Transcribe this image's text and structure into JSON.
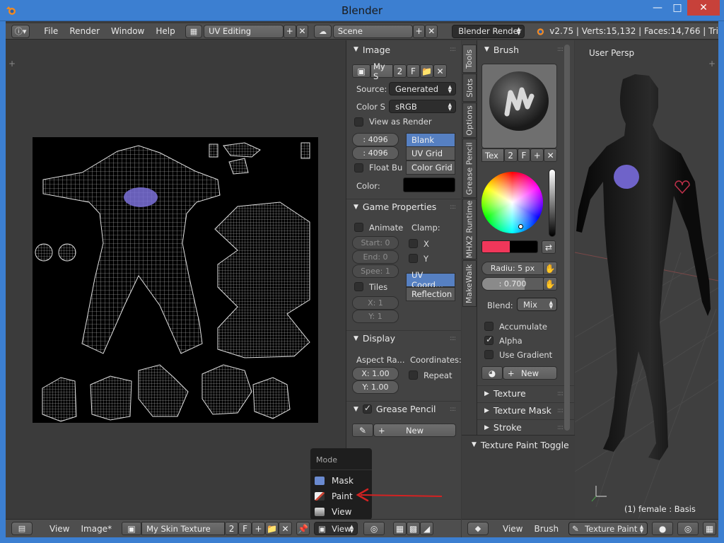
{
  "window": {
    "title": "Blender"
  },
  "info_header": {
    "menus": [
      "File",
      "Render",
      "Window",
      "Help"
    ],
    "screen_layout": "UV Editing",
    "scene": "Scene",
    "render_engine": "Blender Render",
    "stats": "v2.75 | Verts:15,132 | Faces:14,766 | Tri"
  },
  "image_panel": {
    "header": "Image",
    "image_name_short": "My S",
    "users": "2",
    "fake_user": "F",
    "source_label": "Source:",
    "source_value": "Generated",
    "color_space_label": "Color S",
    "color_space_value": "sRGB",
    "view_as_render": "View as Render",
    "width": ": 4096",
    "height": ": 4096",
    "float_buffer": "Float Bu",
    "generated_types": [
      "Blank",
      "UV Grid",
      "Color Grid"
    ],
    "color_label": "Color:"
  },
  "game_properties": {
    "header": "Game Properties",
    "animate": "Animate",
    "clamp_label": "Clamp:",
    "start": "Start: 0",
    "end": "End:  0",
    "speed": "Spee: 1",
    "clamp_x": "X",
    "clamp_y": "Y",
    "tiles": "Tiles",
    "tiles_x": "X:       1",
    "tiles_y": "Y:       1",
    "mapping": [
      "UV Coord...",
      "Reflection"
    ]
  },
  "display_panel": {
    "header": "Display",
    "aspect_label": "Aspect Ra...",
    "coordinates_label": "Coordinates:",
    "aspect_x": "X: 1.00",
    "aspect_y": "Y: 1.00",
    "repeat": "Repeat"
  },
  "grease_pencil_panel": {
    "header": "Grease Pencil",
    "new_label": "New"
  },
  "side_tabs": [
    "Tools",
    "Slots",
    "Options",
    "Grease Pencil",
    "MHX2 Runtime",
    "MakeWalk"
  ],
  "brush_panel": {
    "header": "Brush",
    "texture_short": "Tex",
    "users": "2",
    "fake_user": "F",
    "radius": "Radiu: 5 px",
    "strength": ": 0.700",
    "blend_label": "Blend:",
    "blend_value": "Mix",
    "accumulate": "Accumulate",
    "alpha": "Alpha",
    "use_gradient": "Use Gradient",
    "new_label": "New",
    "primary_color": "#f0375a",
    "secondary_color": "#000000"
  },
  "collapsed_panels": [
    "Texture",
    "Texture Mask",
    "Stroke"
  ],
  "toggle_panel": "Texture Paint Toggle",
  "mode_menu": {
    "title": "Mode",
    "items": [
      "Mask",
      "Paint",
      "View"
    ]
  },
  "uv_header": {
    "menus": [
      "View",
      "Image*"
    ],
    "image_name": "My Skin Texture",
    "users": "2",
    "fake_user": "F",
    "mode_value": "View"
  },
  "view3d": {
    "label": "User Persp",
    "object_info": "(1) female : Basis"
  },
  "view3d_header": {
    "menus": [
      "View",
      "Brush"
    ],
    "mode": "Texture Paint"
  },
  "colors": {
    "accent_blue": "#5680c2",
    "window_frame": "#3c7fd1",
    "close_red": "#c7413a",
    "annotation_red": "#d42222"
  }
}
